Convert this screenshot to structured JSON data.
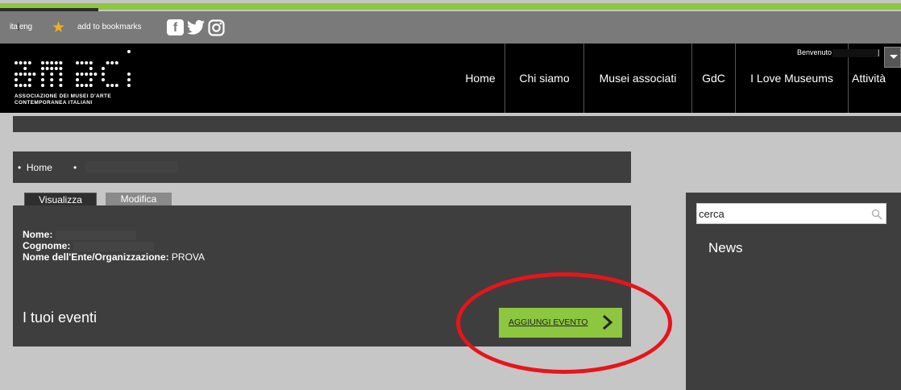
{
  "topbar": {
    "lang_ita": "ita",
    "lang_sep": "|",
    "lang_eng": "eng",
    "bookmark_label": "add to bookmarks",
    "social_icons": [
      "facebook-icon",
      "twitter-icon",
      "instagram-icon"
    ]
  },
  "header": {
    "logo_line1": "ASSOCIAZIONE DEI MUSEI D'ARTE",
    "logo_line2": "CONTEMPORANEA ITALIANI",
    "welcome": "Benvenuto",
    "pipe": "|",
    "nav": [
      "Home",
      "Chi siamo",
      "Musei associati",
      "GdC",
      "I Love Museums",
      "Attività"
    ]
  },
  "breadcrumb": {
    "bullet": "•",
    "home": "Home"
  },
  "tabs": {
    "view": "Visualizza",
    "edit": "Modifica"
  },
  "profile": {
    "nome_label": "Nome",
    "cognome_label": "Cognome",
    "ente_label": "Nome dell'Ente/Organizzazione",
    "ente_value": "PROVA",
    "events_title": "I tuoi eventi",
    "add_event": "AGGIUNGI EVENTO"
  },
  "sidebar": {
    "search_placeholder": "cerca",
    "news_title": "News"
  },
  "colors": {
    "accent_green": "#8dc63f",
    "annotation_red": "#e8141a",
    "panel_dark": "#3e3e3e"
  }
}
